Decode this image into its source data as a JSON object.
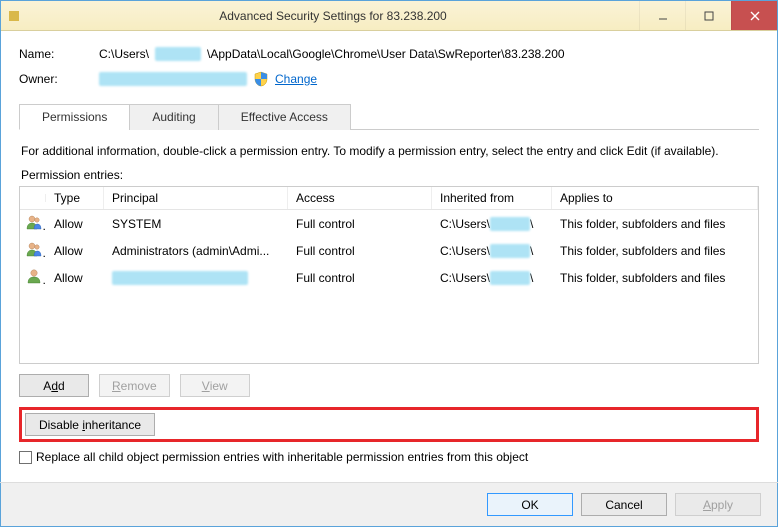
{
  "window": {
    "title": "Advanced Security Settings for 83.238.200"
  },
  "fields": {
    "name_label": "Name:",
    "name_prefix": "C:\\Users\\",
    "name_blur": "xxxxx",
    "name_suffix": "\\AppData\\Local\\Google\\Chrome\\User Data\\SwReporter\\83.238.200",
    "owner_label": "Owner:",
    "owner_blur": "xxxxxxxxxxxxxxxxxxxxxx",
    "change_link": "Change"
  },
  "tabs": {
    "permissions": "Permissions",
    "auditing": "Auditing",
    "effective": "Effective Access"
  },
  "info_text": "For additional information, double-click a permission entry. To modify a permission entry, select the entry and click Edit (if available).",
  "entries_label": "Permission entries:",
  "columns": {
    "type": "Type",
    "principal": "Principal",
    "access": "Access",
    "inherited": "Inherited from",
    "applies": "Applies to"
  },
  "rows": [
    {
      "type": "Allow",
      "principal": "SYSTEM",
      "access": "Full control",
      "inherited_prefix": "C:\\Users\\",
      "inherited_blur": "xxxx",
      "inherited_suffix": "\\",
      "applies": "This folder, subfolders and files"
    },
    {
      "type": "Allow",
      "principal": "Administrators (admin\\Admi...",
      "access": "Full control",
      "inherited_prefix": "C:\\Users\\",
      "inherited_blur": "xxxx",
      "inherited_suffix": "\\",
      "applies": "This folder, subfolders and files"
    },
    {
      "type": "Allow",
      "principal_blur": "xxxxxxxxxxxxxxxxxxxx",
      "access": "Full control",
      "inherited_prefix": "C:\\Users\\",
      "inherited_blur": "xxxx",
      "inherited_suffix": "\\",
      "applies": "This folder, subfolders and files"
    }
  ],
  "buttons": {
    "add": "Add",
    "remove": "Remove",
    "view": "View",
    "disable_inheritance": "Disable inheritance",
    "ok": "OK",
    "cancel": "Cancel",
    "apply": "Apply"
  },
  "checkbox_label": "Replace all child object permission entries with inheritable permission entries from this object"
}
